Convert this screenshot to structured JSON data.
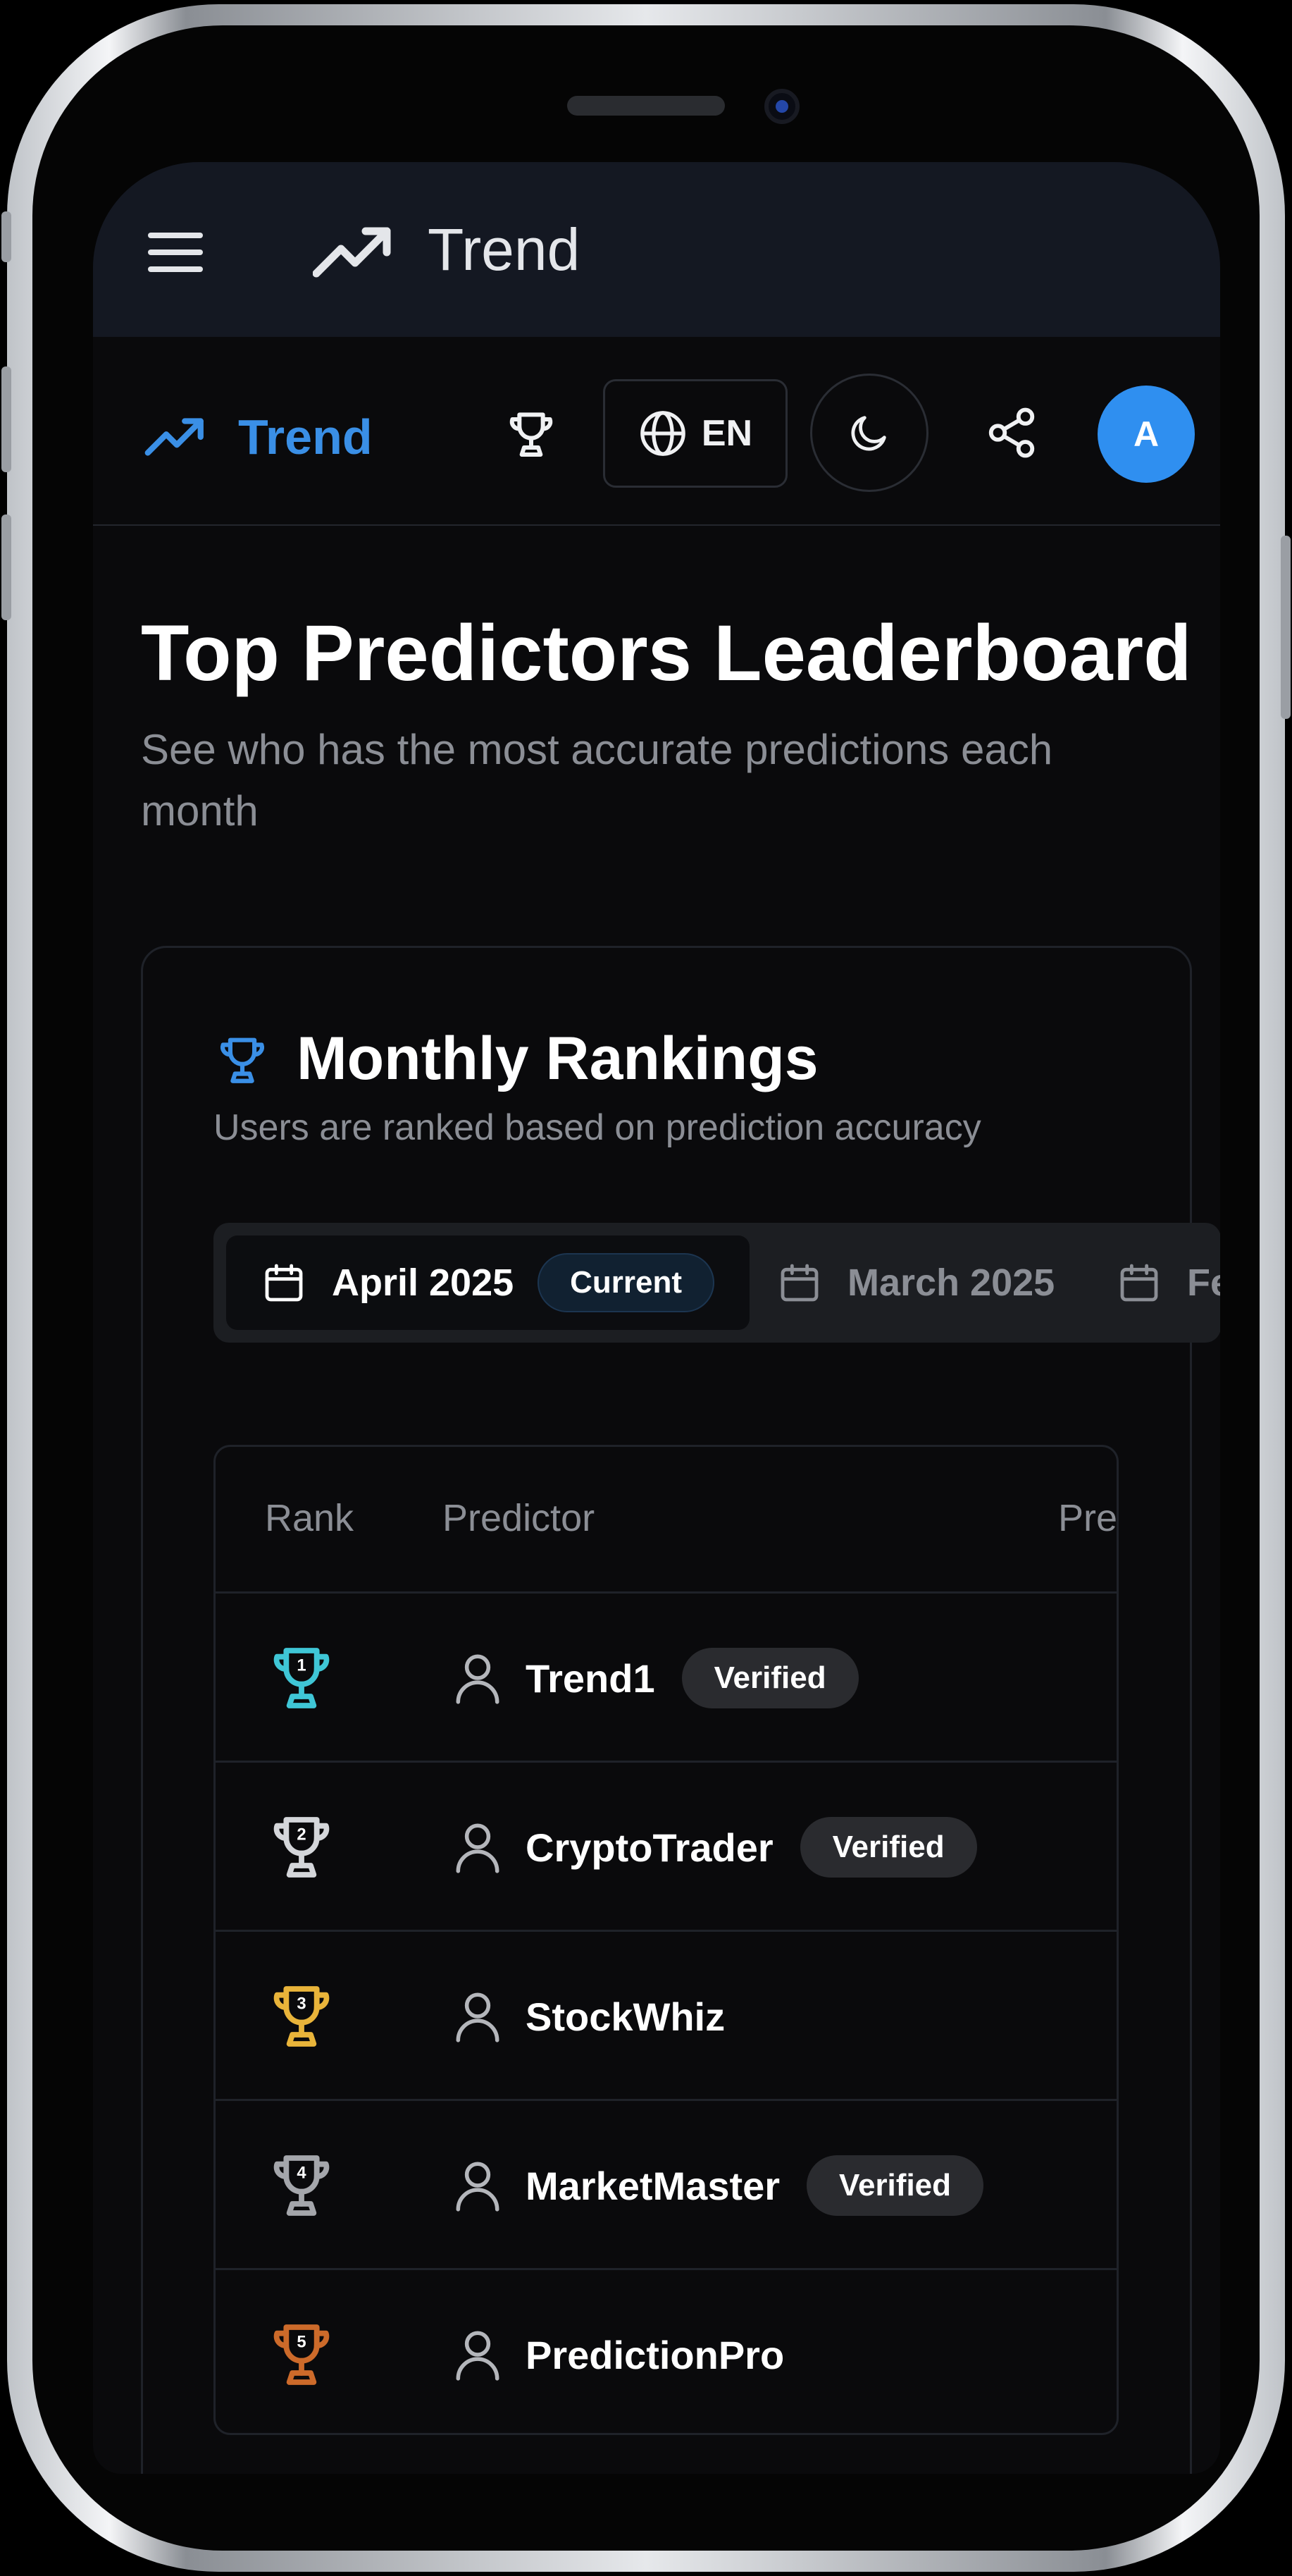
{
  "appbar": {
    "title": "Trend",
    "menu_icon": "hamburger-menu-icon",
    "logo_icon": "trending-up-icon"
  },
  "nav": {
    "brand": "Trend",
    "brand_color": "#3a8fe6",
    "leaderboard_icon": "trophy-icon",
    "language_label": "EN",
    "language_icon": "globe-icon",
    "theme_icon": "moon-icon",
    "share_icon": "share-icon",
    "avatar_initial": "A",
    "avatar_color": "#2f8ff0"
  },
  "page": {
    "title": "Top Predictors Leaderboard",
    "subtitle": "See who has the most accurate predictions each month"
  },
  "rankings": {
    "title": "Monthly Rankings",
    "subtitle": "Users are ranked based on prediction accuracy",
    "tabs": [
      {
        "label": "April 2025",
        "badge": "Current",
        "active": true
      },
      {
        "label": "March 2025",
        "active": false
      },
      {
        "label": "Fe",
        "active": false
      }
    ],
    "columns": [
      "Rank",
      "Predictor",
      "Pre"
    ],
    "rows": [
      {
        "rank": "1",
        "name": "Trend1",
        "verified": "Verified",
        "trophy_color": "#3fc6d6"
      },
      {
        "rank": "2",
        "name": "CryptoTrader",
        "verified": "Verified",
        "trophy_color": "#d4d6da"
      },
      {
        "rank": "3",
        "name": "StockWhiz",
        "verified": "",
        "trophy_color": "#e9b43a"
      },
      {
        "rank": "4",
        "name": "MarketMaster",
        "verified": "Verified",
        "trophy_color": "#a4a6ab"
      },
      {
        "rank": "5",
        "name": "PredictionPro",
        "verified": "",
        "trophy_color": "#cc6a2a"
      }
    ]
  }
}
